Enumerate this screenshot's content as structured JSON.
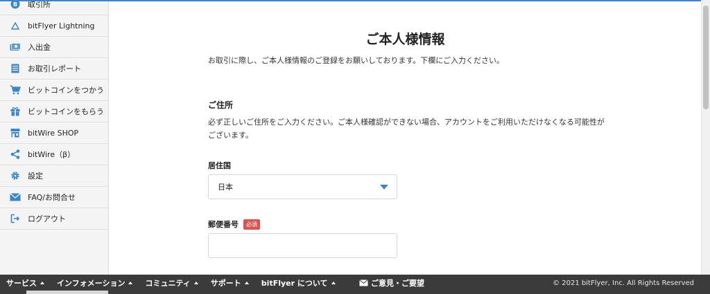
{
  "sidebar": {
    "items": [
      {
        "label": "取引所",
        "icon": "bitcoin-icon"
      },
      {
        "label": "bitFlyer Lightning",
        "icon": "lightning-triangle-icon"
      },
      {
        "label": "入出金",
        "icon": "money-icon"
      },
      {
        "label": "お取引レポート",
        "icon": "report-icon"
      },
      {
        "label": "ビットコインをつかう",
        "icon": "cart-icon"
      },
      {
        "label": "ビットコインをもらう",
        "icon": "gift-icon"
      },
      {
        "label": "bitWire SHOP",
        "icon": "shop-icon"
      },
      {
        "label": "bitWire（β）",
        "icon": "share-icon"
      },
      {
        "label": "設定",
        "icon": "gear-icon"
      },
      {
        "label": "FAQ/お問合せ",
        "icon": "mail-icon"
      },
      {
        "label": "ログアウト",
        "icon": "logout-icon"
      }
    ]
  },
  "main": {
    "title": "ご本人様情報",
    "intro": "お取引に際し、ご本人様情報のご登録をお願いしております。下欄にご入力ください。",
    "address_section": {
      "title": "ご住所",
      "description": "必ず正しいご住所をご入力ください。ご本人様確認ができない場合、アカウントをご利用いただけなくなる可能性がございます。"
    },
    "country": {
      "label": "居住国",
      "selected": "日本"
    },
    "postal_code": {
      "label": "郵便番号",
      "required_badge": "必須",
      "value": "",
      "placeholder": ""
    }
  },
  "footer": {
    "nav": [
      "サービス",
      "インフォメーション",
      "コミュニティ",
      "サポート",
      "bitFlyer について"
    ],
    "feedback": "ご意見・ご要望",
    "copyright": "© 2021 bitFlyer, Inc. All Rights Reserved"
  },
  "colors": {
    "accent": "#3a86c8",
    "required": "#d9534f",
    "footer_bg": "#3b3b3b",
    "sidebar_bg": "#f4f4f4"
  }
}
